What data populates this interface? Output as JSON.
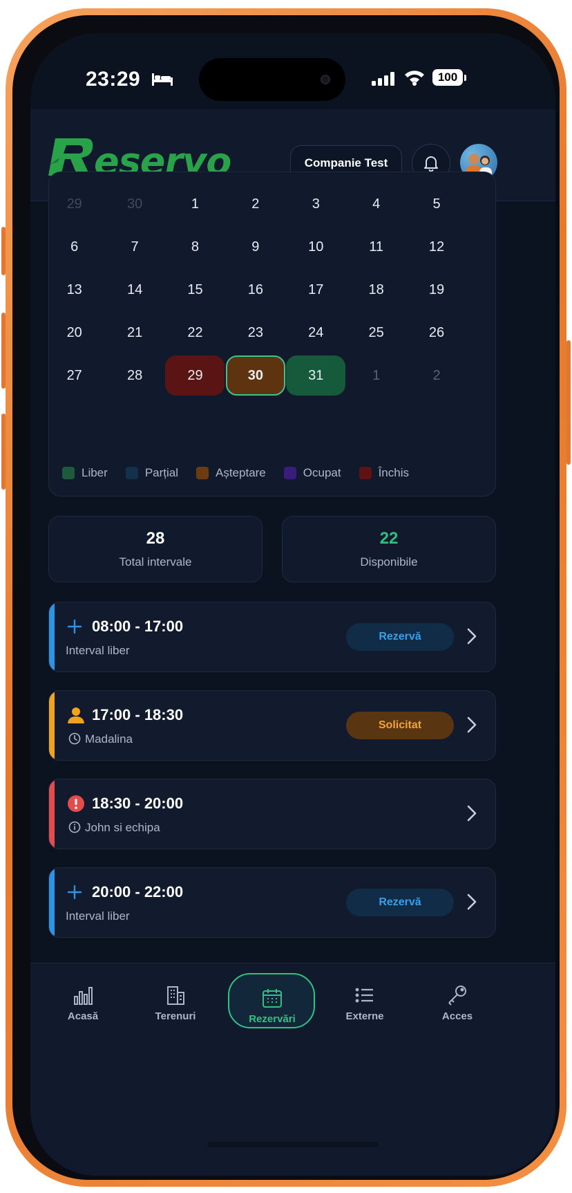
{
  "status_bar": {
    "time": "23:29",
    "battery": "100"
  },
  "header": {
    "logo_text": "eservo",
    "company": "Companie Test"
  },
  "calendar": {
    "weeks": [
      [
        "29",
        "30",
        "1",
        "2",
        "3",
        "4",
        "5"
      ],
      [
        "6",
        "7",
        "8",
        "9",
        "10",
        "11",
        "12"
      ],
      [
        "13",
        "14",
        "15",
        "16",
        "17",
        "18",
        "19"
      ],
      [
        "20",
        "21",
        "22",
        "23",
        "24",
        "25",
        "26"
      ],
      [
        "27",
        "28",
        "29",
        "30",
        "31",
        "1",
        "2"
      ]
    ],
    "legend": [
      {
        "label": "Liber",
        "color": "#1f5a3c"
      },
      {
        "label": "Parțial",
        "color": "#15304a"
      },
      {
        "label": "Așteptare",
        "color": "#6b3c12"
      },
      {
        "label": "Ocupat",
        "color": "#3a1d7a"
      },
      {
        "label": "Închis",
        "color": "#5e1212"
      }
    ]
  },
  "stats": {
    "total": {
      "value": "28",
      "label": "Total intervale"
    },
    "available": {
      "value": "22",
      "label": "Disponibile"
    }
  },
  "slots": [
    {
      "time": "08:00 - 17:00",
      "subtitle": "Interval liber",
      "button": "Rezervă",
      "accent": "#2f93e4",
      "icon": "plus-icon"
    },
    {
      "time": "17:00 - 18:30",
      "subtitle": "Madalina",
      "button": "Solicitat",
      "accent": "#f0a320",
      "icon": "user-icon"
    },
    {
      "time": "18:30 - 20:00",
      "subtitle": "John si echipa",
      "button": "",
      "accent": "#e24c4c",
      "icon": "alert-icon"
    },
    {
      "time": "20:00 - 22:00",
      "subtitle": "Interval liber",
      "button": "Rezervă",
      "accent": "#2f93e4",
      "icon": "plus-icon"
    }
  ],
  "nav": [
    {
      "label": "Acasă",
      "icon": "chart-icon"
    },
    {
      "label": "Terenuri",
      "icon": "building-icon"
    },
    {
      "label": "Rezervări",
      "icon": "calendar-icon"
    },
    {
      "label": "Externe",
      "icon": "list-icon"
    },
    {
      "label": "Acces",
      "icon": "key-icon"
    }
  ]
}
